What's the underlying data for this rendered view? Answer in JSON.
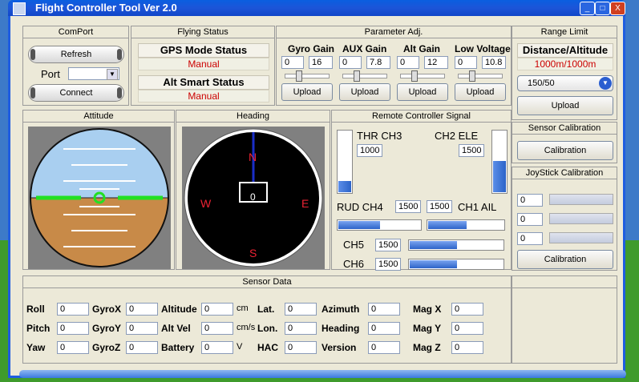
{
  "window": {
    "title": "Flight Controller Tool  Ver 2.0",
    "buttons": [
      "_",
      "□",
      "X"
    ]
  },
  "comport": {
    "title": "ComPort",
    "refresh": "Refresh",
    "port_label": "Port",
    "port_value": "",
    "connect": "Connect"
  },
  "flying_status": {
    "title": "Flying Status",
    "gps_title": "GPS Mode Status",
    "gps_value": "Manual",
    "alt_title": "Alt Smart Status",
    "alt_value": "Manual"
  },
  "param_adj": {
    "title": "Parameter Adj.",
    "items": [
      {
        "label": "Gyro Gain",
        "min": "0",
        "value": "16",
        "upload": "Upload"
      },
      {
        "label": "AUX Gain",
        "min": "0",
        "value": "7.8",
        "upload": "Upload"
      },
      {
        "label": "Alt Gain",
        "min": "0",
        "value": "12",
        "upload": "Upload"
      },
      {
        "label": "Low Voltage",
        "min": "0",
        "value": "10.8",
        "upload": "Upload"
      }
    ]
  },
  "range_limit": {
    "title": "Range Limit",
    "dist_title": "Distance/Altitude",
    "dist_value": "1000m/1000m",
    "select_value": "150/50",
    "upload": "Upload"
  },
  "attitude": {
    "title": "Attitude"
  },
  "heading": {
    "title": "Heading",
    "n": "N",
    "s": "S",
    "e": "E",
    "w": "W",
    "value": "0"
  },
  "rc_signal": {
    "title": "Remote Controller Signal",
    "thr_label": "THR CH3",
    "thr_value": "1000",
    "thr_level": 0.18,
    "ele_label": "CH2 ELE",
    "ele_value": "1500",
    "ele_level": 0.5,
    "rud_label": "RUD CH4",
    "rud_value": "1500",
    "rud_level": 0.5,
    "ail_label": "CH1 AIL",
    "ail_value": "1500",
    "ail_level": 0.5,
    "ch5_label": "CH5",
    "ch5_value": "1500",
    "ch5_level": 0.5,
    "ch6_label": "CH6",
    "ch6_value": "1500",
    "ch6_level": 0.5
  },
  "sensor_calibration": {
    "title": "Sensor Calibration",
    "button": "Calibration"
  },
  "joystick_calibration": {
    "title": "JoyStick Calibration",
    "values": [
      "0",
      "0",
      "0"
    ],
    "button": "Calibration"
  },
  "sensor_data": {
    "title": "Sensor Data",
    "rows": [
      [
        {
          "label": "Roll",
          "value": "0"
        },
        {
          "label": "GyroX",
          "value": "0"
        },
        {
          "label": "Altitude",
          "value": "0",
          "unit": "cm"
        },
        {
          "label": "Lat.",
          "value": "0"
        },
        {
          "label": "Azimuth",
          "value": "0"
        },
        {
          "label": "Mag X",
          "value": "0"
        }
      ],
      [
        {
          "label": "Pitch",
          "value": "0"
        },
        {
          "label": "GyroY",
          "value": "0"
        },
        {
          "label": "Alt Vel",
          "value": "0",
          "unit": "cm/s"
        },
        {
          "label": "Lon.",
          "value": "0"
        },
        {
          "label": "Heading",
          "value": "0"
        },
        {
          "label": "Mag Y",
          "value": "0"
        }
      ],
      [
        {
          "label": "Yaw",
          "value": "0"
        },
        {
          "label": "GyroZ",
          "value": "0"
        },
        {
          "label": "Battery",
          "value": "0",
          "unit": "V"
        },
        {
          "label": "HAC",
          "value": "0"
        },
        {
          "label": "Version",
          "value": "0"
        },
        {
          "label": "Mag Z",
          "value": "0"
        }
      ]
    ]
  },
  "colors": {
    "accent": "#1f5de0",
    "status_red": "#cc0000",
    "sky": "#a9cff0",
    "ground": "#c88a48",
    "horizon": "#22e022"
  }
}
